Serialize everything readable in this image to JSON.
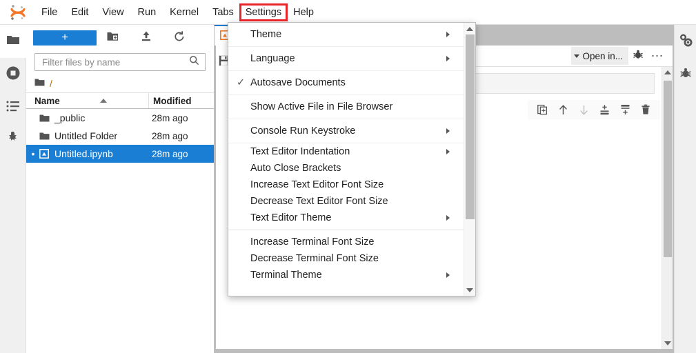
{
  "app": {
    "logo_icon": "jupyter-logo"
  },
  "menubar": {
    "items": [
      {
        "label": "File",
        "highlighted": false
      },
      {
        "label": "Edit",
        "highlighted": false
      },
      {
        "label": "View",
        "highlighted": false
      },
      {
        "label": "Run",
        "highlighted": false
      },
      {
        "label": "Kernel",
        "highlighted": false
      },
      {
        "label": "Tabs",
        "highlighted": false
      },
      {
        "label": "Settings",
        "highlighted": true
      },
      {
        "label": "Help",
        "highlighted": false
      }
    ],
    "highlight_color": "#e8232a"
  },
  "activitybar": {
    "items": [
      {
        "name": "file-browser",
        "icon": "folder-icon",
        "active": true
      },
      {
        "name": "running-sessions",
        "icon": "stop-circle-icon",
        "active": false
      },
      {
        "name": "table-of-contents",
        "icon": "list-icon",
        "active": false
      },
      {
        "name": "extension-manager",
        "icon": "puzzle-icon",
        "active": false
      }
    ]
  },
  "filebrowser": {
    "new_launcher_label": "+",
    "toolbar_icons": [
      "new-folder-icon",
      "upload-icon",
      "refresh-icon"
    ],
    "filter": {
      "placeholder": "Filter files by name",
      "value": ""
    },
    "search_icon": "search-icon",
    "breadcrumb": {
      "icon": "folder-icon",
      "path": "/"
    },
    "columns": {
      "name": "Name",
      "modified": "Modified"
    },
    "sort_indicator": "sort-asc-icon",
    "rows": [
      {
        "name": "_public",
        "modified": "28m ago",
        "icon": "folder-icon",
        "selected": false,
        "running": false
      },
      {
        "name": "Untitled Folder",
        "modified": "28m ago",
        "icon": "folder-icon",
        "selected": false,
        "running": false
      },
      {
        "name": "Untitled.ipynb",
        "modified": "28m ago",
        "icon": "notebook-icon",
        "selected": true,
        "running": true
      }
    ],
    "selected_color": "#1a7fd4"
  },
  "notebook": {
    "tab_label": "",
    "tab_icon": "notebook-orange-icon",
    "save_icon": "save-icon",
    "toolbar": {
      "open_in_label": "Open in...",
      "open_in_caret": "caret-down-icon",
      "debug_icon": "bug-icon",
      "overflow_icon": "ellipsis-icon"
    },
    "cell_toolbar_icons": [
      {
        "name": "duplicate-cell-icon",
        "disabled": false
      },
      {
        "name": "move-cell-up-icon",
        "disabled": false
      },
      {
        "name": "move-cell-down-icon",
        "disabled": true
      },
      {
        "name": "insert-cell-above-icon",
        "disabled": false
      },
      {
        "name": "insert-cell-below-icon",
        "disabled": false
      },
      {
        "name": "delete-cell-icon",
        "disabled": false
      }
    ],
    "active_cell_color": "#5b9fdb"
  },
  "rightbar": {
    "items": [
      {
        "name": "property-inspector",
        "icon": "gears-icon"
      },
      {
        "name": "debugger",
        "icon": "bug-icon"
      }
    ]
  },
  "settings_menu": {
    "items": [
      {
        "label": "Theme",
        "submenu": true,
        "checked": false,
        "separator_below": true,
        "compact": false
      },
      {
        "label": "Language",
        "submenu": true,
        "checked": false,
        "separator_below": true,
        "compact": false
      },
      {
        "label": "Autosave Documents",
        "submenu": false,
        "checked": true,
        "separator_below": true,
        "compact": false
      },
      {
        "label": "Show Active File in File Browser",
        "submenu": false,
        "checked": false,
        "separator_below": true,
        "compact": false
      },
      {
        "label": "Console Run Keystroke",
        "submenu": true,
        "checked": false,
        "separator_below": true,
        "compact": false
      },
      {
        "label": "Text Editor Indentation",
        "submenu": true,
        "checked": false,
        "separator_below": false,
        "compact": true
      },
      {
        "label": "Auto Close Brackets",
        "submenu": false,
        "checked": false,
        "separator_below": false,
        "compact": true
      },
      {
        "label": "Increase Text Editor Font Size",
        "submenu": false,
        "checked": false,
        "separator_below": false,
        "compact": true
      },
      {
        "label": "Decrease Text Editor Font Size",
        "submenu": false,
        "checked": false,
        "separator_below": false,
        "compact": true
      },
      {
        "label": "Text Editor Theme",
        "submenu": true,
        "checked": false,
        "separator_below": false,
        "compact": true
      },
      {
        "label": "__SEPARATOR__",
        "submenu": false,
        "checked": false,
        "separator_below": false,
        "compact": false
      },
      {
        "label": "Increase Terminal Font Size",
        "submenu": false,
        "checked": false,
        "separator_below": false,
        "compact": true
      },
      {
        "label": "Decrease Terminal Font Size",
        "submenu": false,
        "checked": false,
        "separator_below": false,
        "compact": true
      },
      {
        "label": "Terminal Theme",
        "submenu": true,
        "checked": false,
        "separator_below": false,
        "compact": true
      }
    ],
    "check_glyph": "✓",
    "scroll_up_icon": "scroll-up-arrow",
    "scroll_down_icon": "scroll-down-arrow"
  }
}
